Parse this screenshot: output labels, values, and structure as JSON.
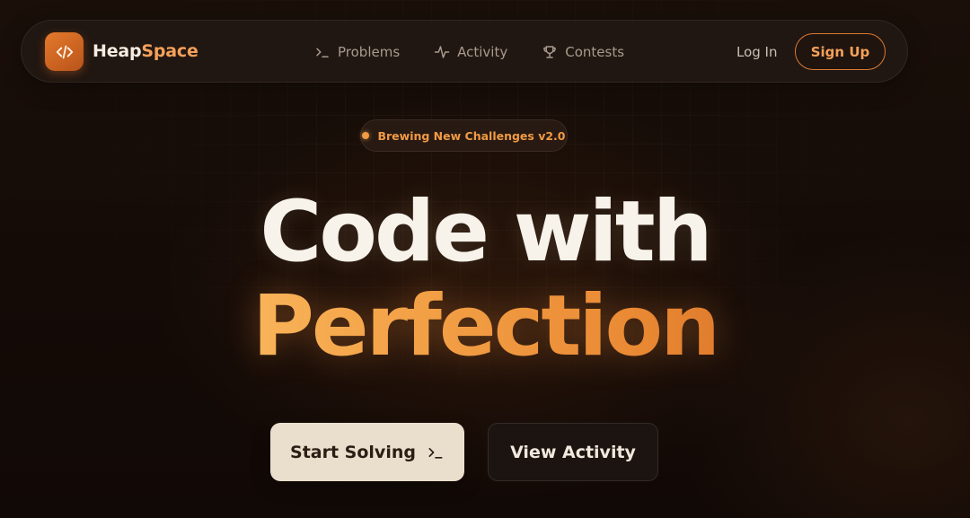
{
  "brand": {
    "name_part1": "Heap",
    "name_part2": "Space",
    "logo_icon": "code-brackets-icon"
  },
  "nav": {
    "links": [
      {
        "label": "Problems",
        "icon": "terminal-prompt-icon"
      },
      {
        "label": "Activity",
        "icon": "pulse-icon"
      },
      {
        "label": "Contests",
        "icon": "trophy-icon"
      }
    ],
    "login_label": "Log In",
    "signup_label": "Sign Up"
  },
  "badge": {
    "text": "Brewing New Challenges v2.0"
  },
  "hero": {
    "line1": "Code with",
    "line2": "Perfection"
  },
  "cta": {
    "primary_label": "Start Solving",
    "primary_icon": "terminal-prompt-icon",
    "secondary_label": "View Activity"
  },
  "colors": {
    "background": "#140c08",
    "accent": "#f5a15a",
    "accent_dark": "#c4581c",
    "primary_button_bg": "#eadfcd",
    "text_light": "#f7f2ea"
  }
}
